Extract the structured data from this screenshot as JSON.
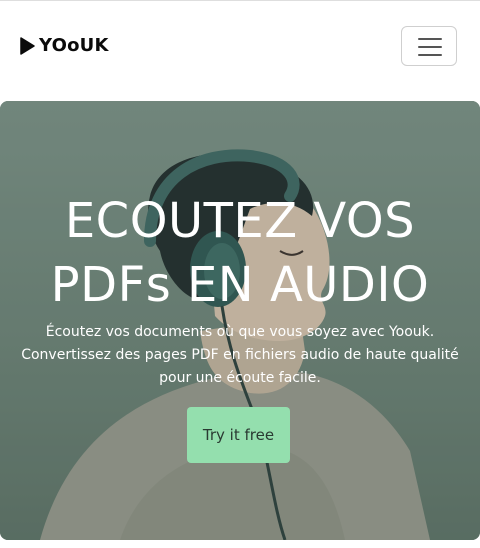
{
  "brand": {
    "name": "YOoUK",
    "logo_icon": "play-triangle-icon"
  },
  "nav": {
    "menu_icon": "hamburger-menu-icon"
  },
  "hero": {
    "title_line1": "ECOUTEZ VOS",
    "title_line2": "PDFs EN AUDIO",
    "subtitle": "Écoutez vos documents où que vous soyez avec Yoouk. Convertissez des pages PDF en fichiers audio de haute qualité pour une écoute facile.",
    "cta_label": "Try it free"
  },
  "colors": {
    "hero_background": "#748a80",
    "cta_background": "#94dfae",
    "text_light": "#ffffff",
    "brand_text": "#0b0b0b"
  }
}
